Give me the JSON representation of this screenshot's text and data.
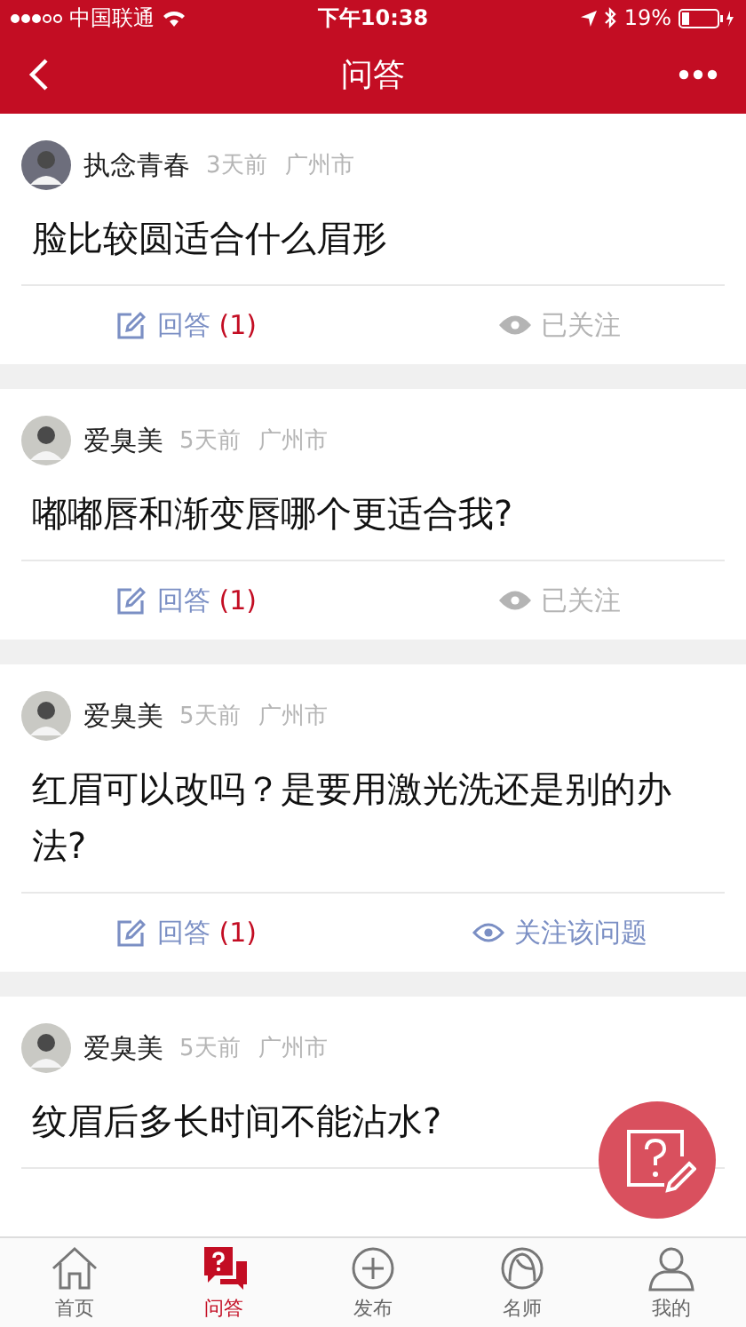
{
  "status_bar": {
    "carrier": "中国联通",
    "time": "下午10:38",
    "battery": "19%"
  },
  "nav": {
    "title": "问答"
  },
  "questions": [
    {
      "user": "执念青春",
      "ago": "3天前",
      "city": "广州市",
      "question": "脸比较圆适合什么眉形",
      "answer_label": "回答",
      "answer_count": "(1)",
      "follow_label": "已关注",
      "followed": true
    },
    {
      "user": "爱臭美",
      "ago": "5天前",
      "city": "广州市",
      "question": "嘟嘟唇和渐变唇哪个更适合我?",
      "answer_label": "回答",
      "answer_count": "(1)",
      "follow_label": "已关注",
      "followed": true
    },
    {
      "user": "爱臭美",
      "ago": "5天前",
      "city": "广州市",
      "question": "红眉可以改吗？是要用激光洗还是别的办法?",
      "answer_label": "回答",
      "answer_count": "(1)",
      "follow_label": "关注该问题",
      "followed": false
    },
    {
      "user": "爱臭美",
      "ago": "5天前",
      "city": "广州市",
      "question": "纹眉后多长时间不能沾水?"
    }
  ],
  "tabs": [
    {
      "label": "首页",
      "kind": "home",
      "selected": false
    },
    {
      "label": "问答",
      "kind": "qa",
      "selected": true
    },
    {
      "label": "发布",
      "kind": "post",
      "selected": false
    },
    {
      "label": "名师",
      "kind": "teacher",
      "selected": false
    },
    {
      "label": "我的",
      "kind": "me",
      "selected": false
    }
  ]
}
